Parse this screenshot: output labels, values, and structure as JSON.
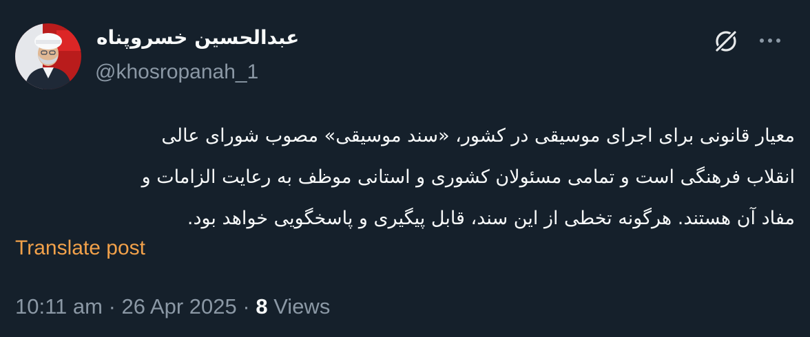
{
  "author": {
    "display_name": "عبدالحسین خسروپناه",
    "handle": "@khosropanah_1"
  },
  "icons": {
    "grok": "grok-icon",
    "more": "more-options-icon"
  },
  "post": {
    "text": "معیار قانونی برای اجرای موسیقی در کشور، «سند موسیقی» مصوب شورای عالی\nانقلاب فرهنگی است و تمامی مسئولان کشوری و استانی موظف به رعایت الزامات و\nمفاد آن هستند. هرگونه تخطی از این سند، قابل پیگیری و پاسخگویی خواهد بود.",
    "translate_label": "Translate post"
  },
  "meta": {
    "time": "10:11 am",
    "separator": "·",
    "date": "26 Apr 2025",
    "views_count": "8",
    "views_label": "Views"
  },
  "colors": {
    "background": "#15202b",
    "text": "#f7f9f9",
    "secondary": "#8b98a5",
    "translate_accent": "#f2a14a"
  }
}
